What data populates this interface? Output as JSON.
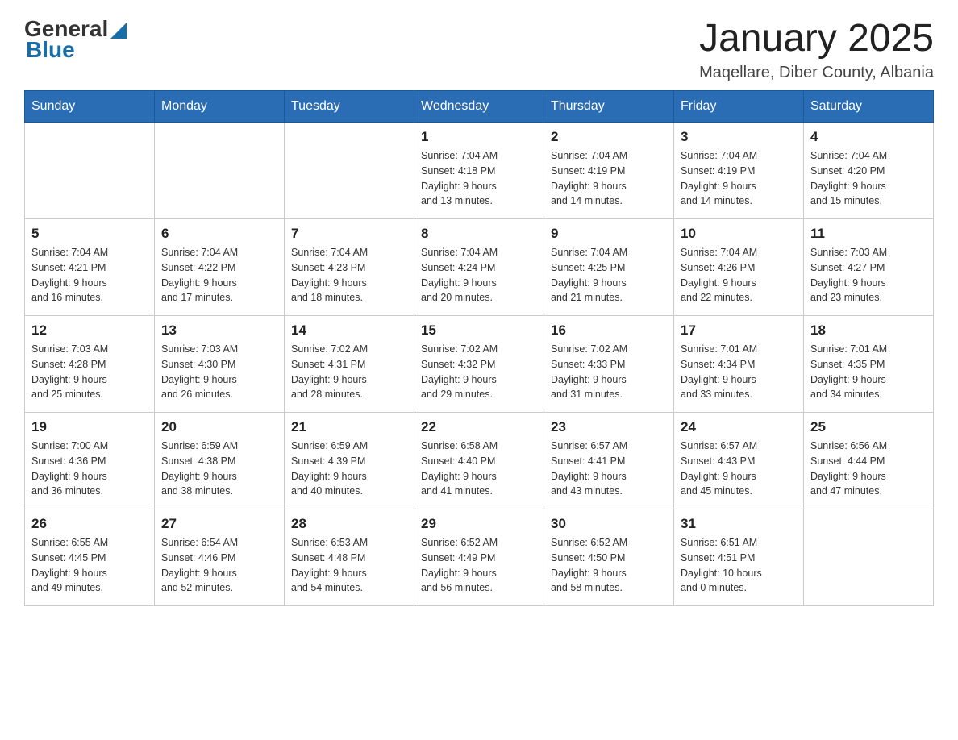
{
  "header": {
    "logo_general": "General",
    "logo_blue": "Blue",
    "month_title": "January 2025",
    "location": "Maqellare, Diber County, Albania"
  },
  "days_of_week": [
    "Sunday",
    "Monday",
    "Tuesday",
    "Wednesday",
    "Thursday",
    "Friday",
    "Saturday"
  ],
  "weeks": [
    [
      {
        "day": "",
        "info": ""
      },
      {
        "day": "",
        "info": ""
      },
      {
        "day": "",
        "info": ""
      },
      {
        "day": "1",
        "info": "Sunrise: 7:04 AM\nSunset: 4:18 PM\nDaylight: 9 hours\nand 13 minutes."
      },
      {
        "day": "2",
        "info": "Sunrise: 7:04 AM\nSunset: 4:19 PM\nDaylight: 9 hours\nand 14 minutes."
      },
      {
        "day": "3",
        "info": "Sunrise: 7:04 AM\nSunset: 4:19 PM\nDaylight: 9 hours\nand 14 minutes."
      },
      {
        "day": "4",
        "info": "Sunrise: 7:04 AM\nSunset: 4:20 PM\nDaylight: 9 hours\nand 15 minutes."
      }
    ],
    [
      {
        "day": "5",
        "info": "Sunrise: 7:04 AM\nSunset: 4:21 PM\nDaylight: 9 hours\nand 16 minutes."
      },
      {
        "day": "6",
        "info": "Sunrise: 7:04 AM\nSunset: 4:22 PM\nDaylight: 9 hours\nand 17 minutes."
      },
      {
        "day": "7",
        "info": "Sunrise: 7:04 AM\nSunset: 4:23 PM\nDaylight: 9 hours\nand 18 minutes."
      },
      {
        "day": "8",
        "info": "Sunrise: 7:04 AM\nSunset: 4:24 PM\nDaylight: 9 hours\nand 20 minutes."
      },
      {
        "day": "9",
        "info": "Sunrise: 7:04 AM\nSunset: 4:25 PM\nDaylight: 9 hours\nand 21 minutes."
      },
      {
        "day": "10",
        "info": "Sunrise: 7:04 AM\nSunset: 4:26 PM\nDaylight: 9 hours\nand 22 minutes."
      },
      {
        "day": "11",
        "info": "Sunrise: 7:03 AM\nSunset: 4:27 PM\nDaylight: 9 hours\nand 23 minutes."
      }
    ],
    [
      {
        "day": "12",
        "info": "Sunrise: 7:03 AM\nSunset: 4:28 PM\nDaylight: 9 hours\nand 25 minutes."
      },
      {
        "day": "13",
        "info": "Sunrise: 7:03 AM\nSunset: 4:30 PM\nDaylight: 9 hours\nand 26 minutes."
      },
      {
        "day": "14",
        "info": "Sunrise: 7:02 AM\nSunset: 4:31 PM\nDaylight: 9 hours\nand 28 minutes."
      },
      {
        "day": "15",
        "info": "Sunrise: 7:02 AM\nSunset: 4:32 PM\nDaylight: 9 hours\nand 29 minutes."
      },
      {
        "day": "16",
        "info": "Sunrise: 7:02 AM\nSunset: 4:33 PM\nDaylight: 9 hours\nand 31 minutes."
      },
      {
        "day": "17",
        "info": "Sunrise: 7:01 AM\nSunset: 4:34 PM\nDaylight: 9 hours\nand 33 minutes."
      },
      {
        "day": "18",
        "info": "Sunrise: 7:01 AM\nSunset: 4:35 PM\nDaylight: 9 hours\nand 34 minutes."
      }
    ],
    [
      {
        "day": "19",
        "info": "Sunrise: 7:00 AM\nSunset: 4:36 PM\nDaylight: 9 hours\nand 36 minutes."
      },
      {
        "day": "20",
        "info": "Sunrise: 6:59 AM\nSunset: 4:38 PM\nDaylight: 9 hours\nand 38 minutes."
      },
      {
        "day": "21",
        "info": "Sunrise: 6:59 AM\nSunset: 4:39 PM\nDaylight: 9 hours\nand 40 minutes."
      },
      {
        "day": "22",
        "info": "Sunrise: 6:58 AM\nSunset: 4:40 PM\nDaylight: 9 hours\nand 41 minutes."
      },
      {
        "day": "23",
        "info": "Sunrise: 6:57 AM\nSunset: 4:41 PM\nDaylight: 9 hours\nand 43 minutes."
      },
      {
        "day": "24",
        "info": "Sunrise: 6:57 AM\nSunset: 4:43 PM\nDaylight: 9 hours\nand 45 minutes."
      },
      {
        "day": "25",
        "info": "Sunrise: 6:56 AM\nSunset: 4:44 PM\nDaylight: 9 hours\nand 47 minutes."
      }
    ],
    [
      {
        "day": "26",
        "info": "Sunrise: 6:55 AM\nSunset: 4:45 PM\nDaylight: 9 hours\nand 49 minutes."
      },
      {
        "day": "27",
        "info": "Sunrise: 6:54 AM\nSunset: 4:46 PM\nDaylight: 9 hours\nand 52 minutes."
      },
      {
        "day": "28",
        "info": "Sunrise: 6:53 AM\nSunset: 4:48 PM\nDaylight: 9 hours\nand 54 minutes."
      },
      {
        "day": "29",
        "info": "Sunrise: 6:52 AM\nSunset: 4:49 PM\nDaylight: 9 hours\nand 56 minutes."
      },
      {
        "day": "30",
        "info": "Sunrise: 6:52 AM\nSunset: 4:50 PM\nDaylight: 9 hours\nand 58 minutes."
      },
      {
        "day": "31",
        "info": "Sunrise: 6:51 AM\nSunset: 4:51 PM\nDaylight: 10 hours\nand 0 minutes."
      },
      {
        "day": "",
        "info": ""
      }
    ]
  ]
}
